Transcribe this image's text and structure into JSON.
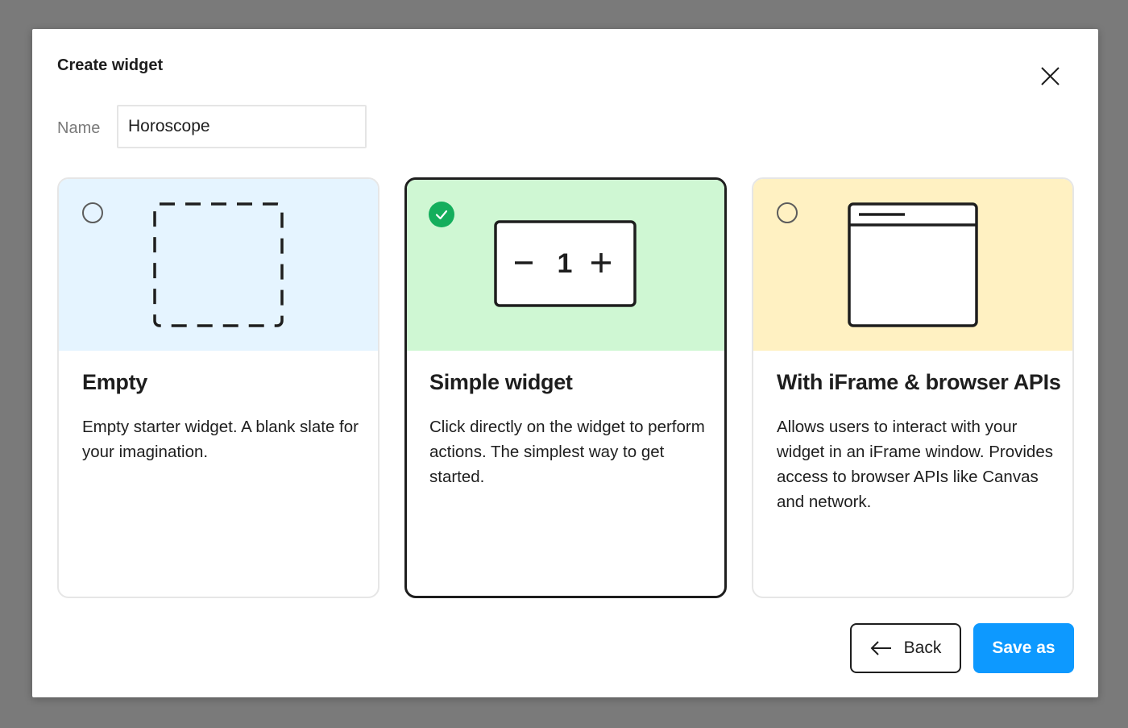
{
  "dialog": {
    "title": "Create widget",
    "close_icon": "close-icon"
  },
  "name_field": {
    "label": "Name",
    "value": "Horoscope"
  },
  "options": [
    {
      "title": "Empty",
      "description": "Empty starter widget. A blank slate for your imagination.",
      "selected": false,
      "illustration_color": "#e5f4ff",
      "icon": "dashed-square-icon"
    },
    {
      "title": "Simple widget",
      "description": "Click directly on the widget to perform actions. The simplest way to get started.",
      "selected": true,
      "illustration_color": "#cff7d3",
      "icon": "counter-widget-icon",
      "counter": {
        "minus": "−",
        "value": "1",
        "plus": "+"
      }
    },
    {
      "title": "With iFrame & browser APIs",
      "description": "Allows users to interact with your widget in an iFrame window. Provides access to browser APIs like Canvas and network.",
      "selected": false,
      "illustration_color": "#fff1c2",
      "icon": "browser-window-icon"
    }
  ],
  "footer": {
    "back_label": "Back",
    "back_icon": "arrow-left-icon",
    "save_label": "Save as"
  },
  "colors": {
    "primary": "#0d99ff",
    "success": "#14ae5c",
    "text": "#1e1e1e"
  }
}
